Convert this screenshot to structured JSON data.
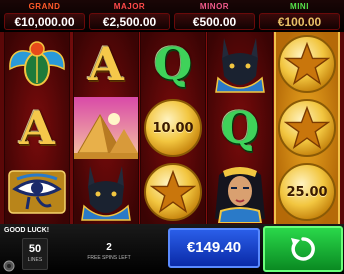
{
  "jackpots": [
    {
      "label": "GRAND",
      "value": "€10,000.00"
    },
    {
      "label": "MAJOR",
      "value": "€2,500.00"
    },
    {
      "label": "MINOR",
      "value": "€500.00"
    },
    {
      "label": "MINI",
      "value": "€100.00"
    }
  ],
  "reels": {
    "r1": [
      "scarab",
      "A",
      "eye-of-horus"
    ],
    "r2": [
      "A",
      "pyramids",
      "anubis"
    ],
    "r3": [
      "Q",
      "10.00",
      "star-coin"
    ],
    "r4": [
      "anubis",
      "Q",
      "cleopatra"
    ],
    "r5": [
      "star-coin",
      "star-coin",
      "25.00"
    ]
  },
  "letters": {
    "a1": "A",
    "a2": "A",
    "q1": "Q",
    "q2": "Q"
  },
  "coin_values": {
    "c1": "10.00",
    "c2": "25.00"
  },
  "status": {
    "message": "GOOD LUCK!"
  },
  "lines": {
    "value": "50",
    "label": "LINES"
  },
  "free_spins": {
    "value": "2",
    "label": "FREE SPINS LEFT"
  },
  "credit": {
    "value": "€149.40"
  },
  "colors": {
    "spin": "#1ec83a",
    "credit": "#1a45d6",
    "reel_frame": "#8c1010",
    "gold": "#f2c640"
  }
}
